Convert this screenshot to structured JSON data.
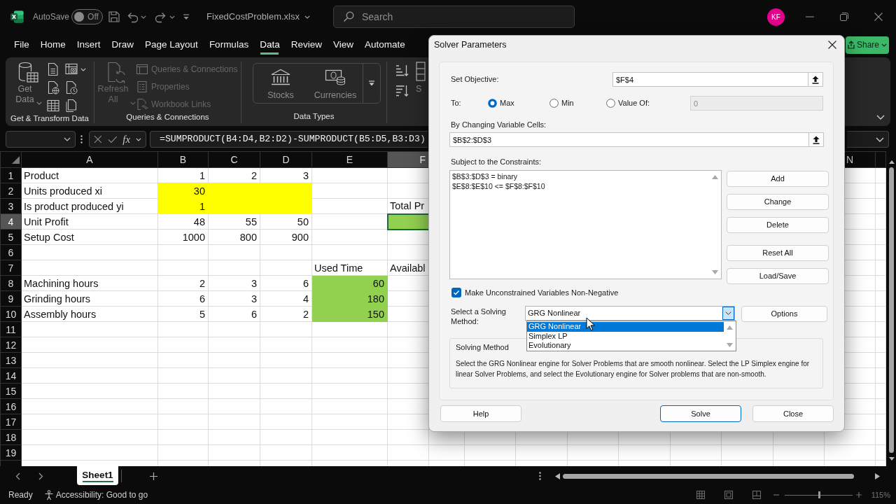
{
  "titlebar": {
    "autosave_label": "AutoSave",
    "autosave": {
      "label": "Off",
      "on": false
    },
    "file_name": "FixedCostProblem.xlsx",
    "search": {
      "placeholder": "Search"
    },
    "avatar": "KF"
  },
  "menu_tabs": [
    {
      "label": "File",
      "selected": false
    },
    {
      "label": "Home",
      "selected": false
    },
    {
      "label": "Insert",
      "selected": false
    },
    {
      "label": "Draw",
      "selected": false
    },
    {
      "label": "Page Layout",
      "selected": false
    },
    {
      "label": "Formulas",
      "selected": false
    },
    {
      "label": "Data",
      "selected": true
    },
    {
      "label": "Review",
      "selected": false
    },
    {
      "label": "View",
      "selected": false
    },
    {
      "label": "Automate",
      "selected": false
    }
  ],
  "share_button": "Share",
  "ribbon": {
    "get_transform": {
      "label": "Get & Transform Data",
      "get_data": "Get Data"
    },
    "queries": {
      "label": "Queries & Connections",
      "refresh_all": {
        "label": "Refresh All",
        "disabled": true
      },
      "items": [
        {
          "label": "Queries & Connections",
          "disabled": true
        },
        {
          "label": "Properties",
          "disabled": true
        },
        {
          "label": "Workbook Links",
          "disabled": true
        }
      ]
    },
    "data_types": {
      "label": "Data Types",
      "items": [
        "Stocks",
        "Currencies"
      ]
    },
    "sort": {
      "label": "S"
    }
  },
  "formula_bar": {
    "function_button": "fx",
    "formula": "=SUMPRODUCT(B4:D4,B2:D2)-SUMPRODUCT(B5:D5,B3:D3)"
  },
  "sheet": {
    "columns": [
      {
        "label": "A",
        "selected": false
      },
      {
        "label": "B",
        "selected": false
      },
      {
        "label": "C",
        "selected": false
      },
      {
        "label": "D",
        "selected": false
      },
      {
        "label": "E",
        "selected": false
      },
      {
        "label": "F",
        "selected": true
      },
      {
        "label": "N",
        "selected": false
      }
    ],
    "rows": [
      {
        "label": "1",
        "selected": false,
        "cells": [
          {
            "text": "Product",
            "kind": "text",
            "selected": false
          },
          {
            "text": "1",
            "kind": "number",
            "selected": false
          },
          {
            "text": "2",
            "kind": "number",
            "selected": false
          },
          {
            "text": "3",
            "kind": "number",
            "selected": false
          },
          {
            "selected": false
          },
          {
            "selected": false
          }
        ]
      },
      {
        "label": "2",
        "selected": false,
        "cells": [
          {
            "text": "Units produced xi",
            "kind": "text",
            "selected": false
          },
          {
            "text": "30",
            "kind": "number",
            "color": "#ffff00",
            "selected": false
          },
          {
            "color": "#ffff00",
            "selected": false
          },
          {
            "color": "#ffff00",
            "selected": false
          },
          {
            "selected": false
          },
          {
            "selected": false
          }
        ]
      },
      {
        "label": "3",
        "selected": false,
        "cells": [
          {
            "text": "Is product produced yi",
            "kind": "text",
            "selected": false
          },
          {
            "text": "1",
            "kind": "number",
            "color": "#ffff00",
            "selected": false
          },
          {
            "color": "#ffff00",
            "selected": false
          },
          {
            "color": "#ffff00",
            "selected": false
          },
          {
            "selected": false
          },
          {
            "text": "Total Pr",
            "kind": "text",
            "selected": false
          }
        ]
      },
      {
        "label": "4",
        "selected": true,
        "cells": [
          {
            "text": "Unit Profit",
            "kind": "text",
            "selected": false
          },
          {
            "text": "48",
            "kind": "number",
            "selected": false
          },
          {
            "text": "55",
            "kind": "number",
            "selected": false
          },
          {
            "text": "50",
            "kind": "number",
            "selected": false
          },
          {
            "selected": false
          },
          {
            "color": "#92d050",
            "selected": true
          }
        ]
      },
      {
        "label": "5",
        "selected": false,
        "cells": [
          {
            "text": "Setup Cost",
            "kind": "text",
            "selected": false
          },
          {
            "text": "1000",
            "kind": "number",
            "selected": false
          },
          {
            "text": "800",
            "kind": "number",
            "selected": false
          },
          {
            "text": "900",
            "kind": "number",
            "selected": false
          },
          {
            "selected": false
          },
          {
            "selected": false
          }
        ]
      },
      {
        "label": "6",
        "selected": false
      },
      {
        "label": "7",
        "selected": false,
        "cells": [
          {
            "selected": false
          },
          {
            "selected": false
          },
          {
            "selected": false
          },
          {
            "selected": false
          },
          {
            "text": "Used Time",
            "kind": "text",
            "selected": false
          },
          {
            "text": "Availabl",
            "kind": "text",
            "selected": false
          }
        ]
      },
      {
        "label": "8",
        "selected": false,
        "cells": [
          {
            "text": "Machining hours",
            "kind": "text",
            "selected": false
          },
          {
            "text": "2",
            "kind": "number",
            "selected": false
          },
          {
            "text": "3",
            "kind": "number",
            "selected": false
          },
          {
            "text": "6",
            "kind": "number",
            "selected": false
          },
          {
            "text": "60",
            "kind": "number",
            "color": "#92d050",
            "selected": false
          },
          {
            "selected": false
          }
        ]
      },
      {
        "label": "9",
        "selected": false,
        "cells": [
          {
            "text": "Grinding hours",
            "kind": "text",
            "selected": false
          },
          {
            "text": "6",
            "kind": "number",
            "selected": false
          },
          {
            "text": "3",
            "kind": "number",
            "selected": false
          },
          {
            "text": "4",
            "kind": "number",
            "selected": false
          },
          {
            "text": "180",
            "kind": "number",
            "color": "#92d050",
            "selected": false
          },
          {
            "selected": false
          }
        ]
      },
      {
        "label": "10",
        "selected": false,
        "cells": [
          {
            "text": "Assembly hours",
            "kind": "text",
            "selected": false
          },
          {
            "text": "5",
            "kind": "number",
            "selected": false
          },
          {
            "text": "6",
            "kind": "number",
            "selected": false
          },
          {
            "text": "2",
            "kind": "number",
            "selected": false
          },
          {
            "text": "150",
            "kind": "number",
            "color": "#92d050",
            "selected": false
          },
          {
            "selected": false
          }
        ]
      },
      {
        "label": "11",
        "selected": false
      },
      {
        "label": "12",
        "selected": false
      },
      {
        "label": "13",
        "selected": false
      },
      {
        "label": "14",
        "selected": false
      },
      {
        "label": "15",
        "selected": false
      },
      {
        "label": "16",
        "selected": false
      },
      {
        "label": "17",
        "selected": false
      },
      {
        "label": "18",
        "selected": false
      },
      {
        "label": "19",
        "selected": false
      }
    ]
  },
  "sheet_tabs": [
    {
      "label": "Sheet1",
      "selected": true
    }
  ],
  "status_bar": {
    "status": "Ready",
    "accessibility": "Accessibility: Good to go",
    "zoom": {
      "level": 0.51,
      "label": "115%"
    }
  },
  "dialog": {
    "title": "Solver Parameters",
    "objective": {
      "label": "Set Objective:",
      "value": "$F$4"
    },
    "to": {
      "label": "To:",
      "options": [
        {
          "label": "Max",
          "selected": true
        },
        {
          "label": "Min",
          "selected": false
        },
        {
          "label": "Value Of:",
          "selected": false
        }
      ],
      "value_of": {
        "value": "0",
        "disabled": true
      }
    },
    "variable_cells": {
      "label": "By Changing Variable Cells:",
      "value": "$B$2:$D$3"
    },
    "constraints": {
      "label": "Subject to the Constraints:",
      "items": [
        "$B$3:$D$3 = binary",
        "$E$8:$E$10 <= $F$8:$F$10"
      ]
    },
    "constraint_buttons": [
      "Add",
      "Change",
      "Delete",
      "Reset All",
      "Load/Save"
    ],
    "non_negative": {
      "label": "Make Unconstrained Variables Non-Negative",
      "checked": true
    },
    "method": {
      "label": "Select a Solving Method:",
      "value": "GRG Nonlinear",
      "expanded": true,
      "options": [
        {
          "label": "GRG Nonlinear",
          "selected": true
        },
        {
          "label": "Simplex LP",
          "selected": false
        },
        {
          "label": "Evolutionary",
          "selected": false
        }
      ]
    },
    "options_button": "Options",
    "description": {
      "title": "Solving Method",
      "text": "Select the GRG Nonlinear engine for Solver Problems that are smooth nonlinear. Select the LP Simplex engine for linear Solver Problems, and select the Evolutionary engine for Solver problems that are non-smooth."
    },
    "buttons": [
      {
        "label": "Help",
        "default": false
      },
      {
        "label": "Solve",
        "default": true
      },
      {
        "label": "Close",
        "default": false
      }
    ]
  }
}
